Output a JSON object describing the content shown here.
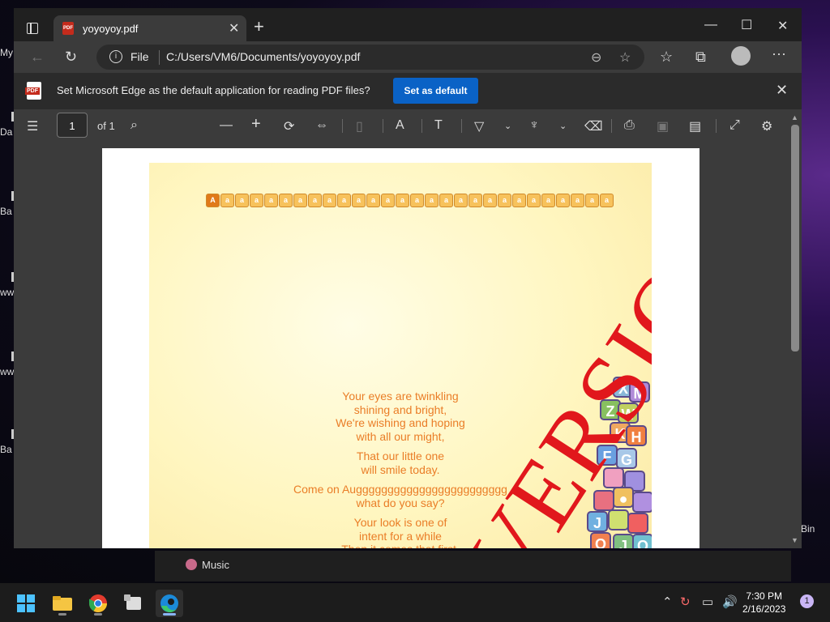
{
  "desktop": {
    "icons": [
      "My",
      "Da",
      "Ba",
      "ww",
      "ww",
      "Ba"
    ],
    "recycle_label": "Bin"
  },
  "browser": {
    "tab_title": "yoyoyoy.pdf",
    "address": {
      "scheme_label": "File",
      "url": "C:/Users/VM6/Documents/yoyoyoy.pdf"
    },
    "infobar": {
      "message": "Set Microsoft Edge as the default application for reading PDF files?",
      "button": "Set as default"
    },
    "pdf_toolbar": {
      "page_number": "1",
      "of_pages": "of 1"
    }
  },
  "document": {
    "watermark": "VERSION",
    "poem": [
      [
        "Your eyes are twinkling",
        "shining and bright,",
        "We're wishing and hoping",
        "with all our might,"
      ],
      [
        "That our little one",
        "will smile today."
      ],
      [
        "Come on Augggggggggggggggggggggggg",
        "what do you say?"
      ],
      [
        "Your look is one of",
        "intent for a while",
        "Then it comes that first,"
      ]
    ],
    "abc_count": 28
  },
  "strip": {
    "music_label": "Music"
  },
  "taskbar": {
    "time": "7:30 PM",
    "date": "2/16/2023",
    "notification_count": "1"
  }
}
